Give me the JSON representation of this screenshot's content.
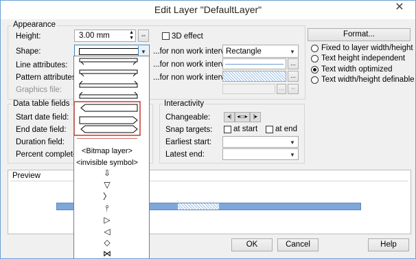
{
  "window": {
    "title": "Edit Layer \"DefaultLayer\"",
    "close_glyph": "✕"
  },
  "appearance": {
    "group_label": "Appearance",
    "height_label": "Height:",
    "height_value": "3.00 mm",
    "effect_3d_label": "3D effect",
    "shape_label": "Shape:",
    "line_attr_label": "Line attributes:",
    "pattern_attr_label": "Pattern attributes:",
    "graphics_file_label": "Graphics file:",
    "non_work_label_1": "...for non work interval:",
    "non_work_label_2": "...for non work interval:",
    "non_work_label_3": "...for non work interval:",
    "non_work_shape_value": "Rectangle",
    "ellipsis": "...",
    "format_button": "Format...",
    "text_options": [
      {
        "label": "Fixed to layer width/height",
        "selected": false
      },
      {
        "label": "Text height independent",
        "selected": false
      },
      {
        "label": "Text width optimized",
        "selected": true
      },
      {
        "label": "Text width/height definable",
        "selected": false
      }
    ]
  },
  "data_table": {
    "group_label": "Data table fields",
    "start_label": "Start date field:",
    "end_label": "End date field:",
    "duration_label": "Duration field:",
    "percent_label": "Percent complete:"
  },
  "interactivity": {
    "group_label": "Interactivity",
    "changeable_label": "Changeable:",
    "changeable_icons": [
      "◂|",
      "◂▭▸",
      "|▸"
    ],
    "snap_label": "Snap targets:",
    "at_start_label": "at start",
    "at_end_label": "at end",
    "earliest_start_label": "Earliest start:",
    "latest_end_label": "Latest end:"
  },
  "preview": {
    "label": "Preview"
  },
  "buttons": {
    "ok": "OK",
    "cancel": "Cancel",
    "help": "Help"
  },
  "shape_list": {
    "bitmap_layer": "<Bitmap layer>",
    "invisible_symbol": "<invisible symbol>",
    "symbols": [
      "⇩",
      "▽",
      "〉",
      "⫯",
      "▷",
      "◁",
      "◇",
      "⋈",
      "▿"
    ]
  },
  "colors": {
    "accent": "#6a9fd3",
    "bar": "#7ea7dc",
    "highlight": "#c0392b"
  }
}
